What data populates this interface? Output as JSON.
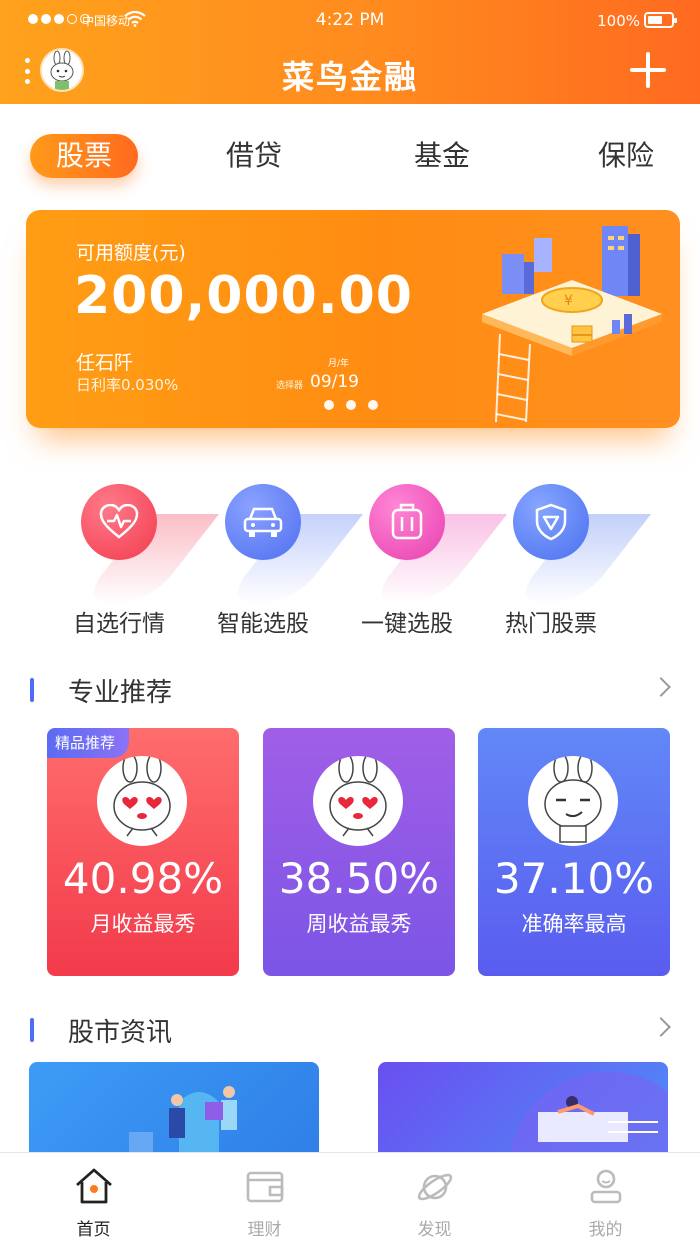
{
  "status_bar": {
    "carrier": "中国移动",
    "time": "4:22 PM",
    "battery": "100%"
  },
  "header": {
    "title": "菜鸟金融"
  },
  "tabs": [
    {
      "label": "股票",
      "active": true
    },
    {
      "label": "借贷",
      "active": false
    },
    {
      "label": "基金",
      "active": false
    },
    {
      "label": "保险",
      "active": false
    }
  ],
  "banner": {
    "label": "可用额度(元)",
    "amount": "200,000.00",
    "holder": "任石阡",
    "rate": "日利率0.030%",
    "expiry_label": "月/年",
    "expiry_pre": "选择器",
    "expiry": "09/19",
    "page_count": 3
  },
  "quick_actions": [
    {
      "label": "自选行情",
      "icon": "heartbeat-icon",
      "color": "#f2455a"
    },
    {
      "label": "智能选股",
      "icon": "car-icon",
      "color": "#5a7bf5"
    },
    {
      "label": "一键选股",
      "icon": "luggage-icon",
      "color": "#f04fb8"
    },
    {
      "label": "热门股票",
      "icon": "shield-icon",
      "color": "#4f78f0"
    }
  ],
  "sections": {
    "recommend": "专业推荐",
    "news": "股市资讯"
  },
  "cards": [
    {
      "badge": "精品推荐",
      "pct": "40.98%",
      "desc": "月收益最秀",
      "colors": [
        "#ff6a6a",
        "#f23b4d"
      ]
    },
    {
      "badge": "",
      "pct": "38.50%",
      "desc": "周收益最秀",
      "colors": [
        "#9a5ce8",
        "#7a53e6"
      ]
    },
    {
      "badge": "",
      "pct": "37.10%",
      "desc": "准确率最高",
      "colors": [
        "#5f86f7",
        "#5a5ef0"
      ]
    }
  ],
  "bottom_nav": [
    {
      "label": "首页",
      "icon": "home-icon",
      "active": true
    },
    {
      "label": "理财",
      "icon": "wallet-icon",
      "active": false
    },
    {
      "label": "发现",
      "icon": "planet-icon",
      "active": false
    },
    {
      "label": "我的",
      "icon": "profile-icon",
      "active": false
    }
  ]
}
